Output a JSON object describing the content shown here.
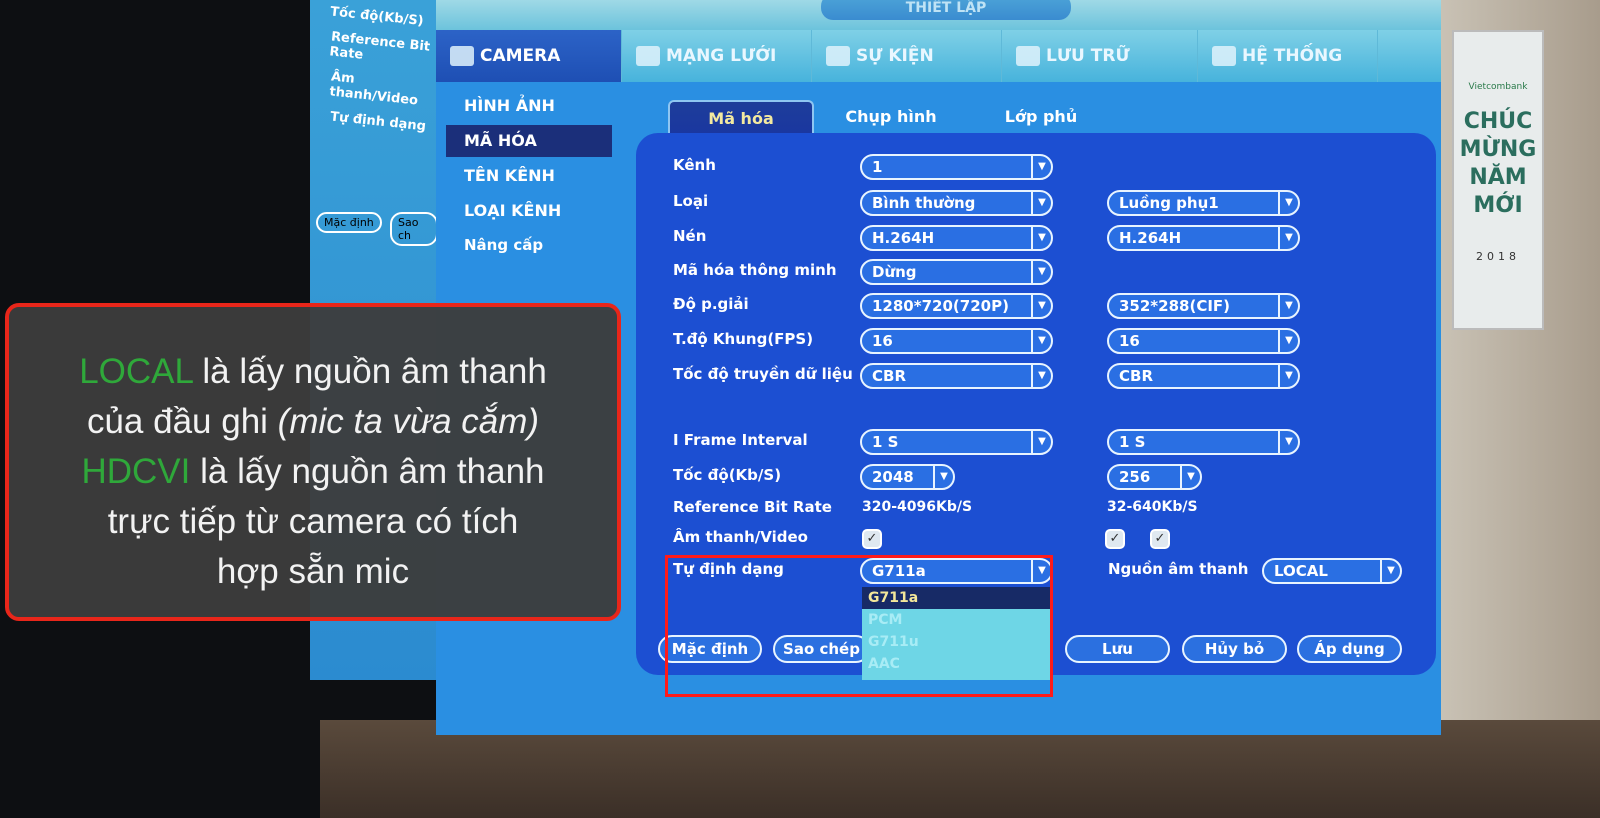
{
  "screen": {
    "title": "THIẾT LẬP",
    "main_tabs": [
      {
        "label": "CAMERA",
        "icon": "camera-icon"
      },
      {
        "label": "MẠNG LƯỚI",
        "icon": "network-icon"
      },
      {
        "label": "SỰ KIỆN",
        "icon": "event-icon"
      },
      {
        "label": "LƯU TRỮ",
        "icon": "storage-icon"
      },
      {
        "label": "HỆ THỐNG",
        "icon": "system-icon"
      }
    ],
    "sidebar": [
      {
        "label": "HÌNH ẢNH"
      },
      {
        "label": "MÃ HÓA"
      },
      {
        "label": "TÊN KÊNH"
      },
      {
        "label": "LOẠI KÊNH"
      },
      {
        "label": "Nâng cấp"
      }
    ],
    "sub_tabs": [
      {
        "label": "Mã hóa"
      },
      {
        "label": "Chụp hình"
      },
      {
        "label": "Lớp phủ"
      }
    ],
    "form": {
      "kenh": {
        "label": "Kênh",
        "main": "1"
      },
      "loai": {
        "label": "Loại",
        "main": "Bình thường",
        "sub": "Luồng phụ1"
      },
      "nen": {
        "label": "Nén",
        "main": "H.264H",
        "sub": "H.264H"
      },
      "smart": {
        "label": "Mã hóa thông minh",
        "main": "Dừng"
      },
      "res": {
        "label": "Độ p.giải",
        "main": "1280*720(720P)",
        "sub": "352*288(CIF)"
      },
      "fps": {
        "label": "T.độ Khung(FPS)",
        "main": "16",
        "sub": "16"
      },
      "bitctl": {
        "label": "Tốc độ truyền dữ liệu",
        "main": "CBR",
        "sub": "CBR"
      },
      "iframe": {
        "label": "I Frame Interval",
        "main": "1 S",
        "sub": "1 S"
      },
      "bitrate": {
        "label": "Tốc độ(Kb/S)",
        "main": "2048",
        "sub": "256"
      },
      "ref": {
        "label": "Reference Bit Rate",
        "main": "320-4096Kb/S",
        "sub": "32-640Kb/S"
      },
      "av": {
        "label": "Âm thanh/Video",
        "main": true,
        "sub1": true,
        "sub2": true
      },
      "format": {
        "label": "Tự định dạng",
        "main": "G711a",
        "options": [
          "G711a",
          "PCM",
          "G711u",
          "AAC"
        ]
      },
      "source": {
        "label": "Nguồn âm thanh",
        "value": "LOCAL"
      }
    },
    "buttons": {
      "default": "Mặc định",
      "copy": "Sao chép",
      "save": "Lưu",
      "cancel": "Hủy bỏ",
      "apply": "Áp dụng"
    }
  },
  "left_screen": {
    "lines": [
      "Tốc độ(Kb/S)",
      "Reference Bit Rate",
      "Âm thanh/Video",
      "Tự định dạng"
    ],
    "btn1": "Mặc định",
    "btn2": "Sao ch"
  },
  "poster": {
    "brand": "Vietcombank",
    "greeting": "CHÚC MỪNG NĂM MỚI",
    "year": "2018"
  },
  "overlay": {
    "w1": "LOCAL",
    "t1": " là lấy nguồn âm thanh",
    "t2": "của đầu ghi ",
    "t2i": "(mic ta vừa cắm)",
    "w2": "HDCVI",
    "t3": " là lấy nguồn âm thanh",
    "t4": "trực tiếp từ camera có tích",
    "t5": "hợp sẵn mic",
    "accent": "#2fa83a",
    "border": "#e8261a"
  }
}
